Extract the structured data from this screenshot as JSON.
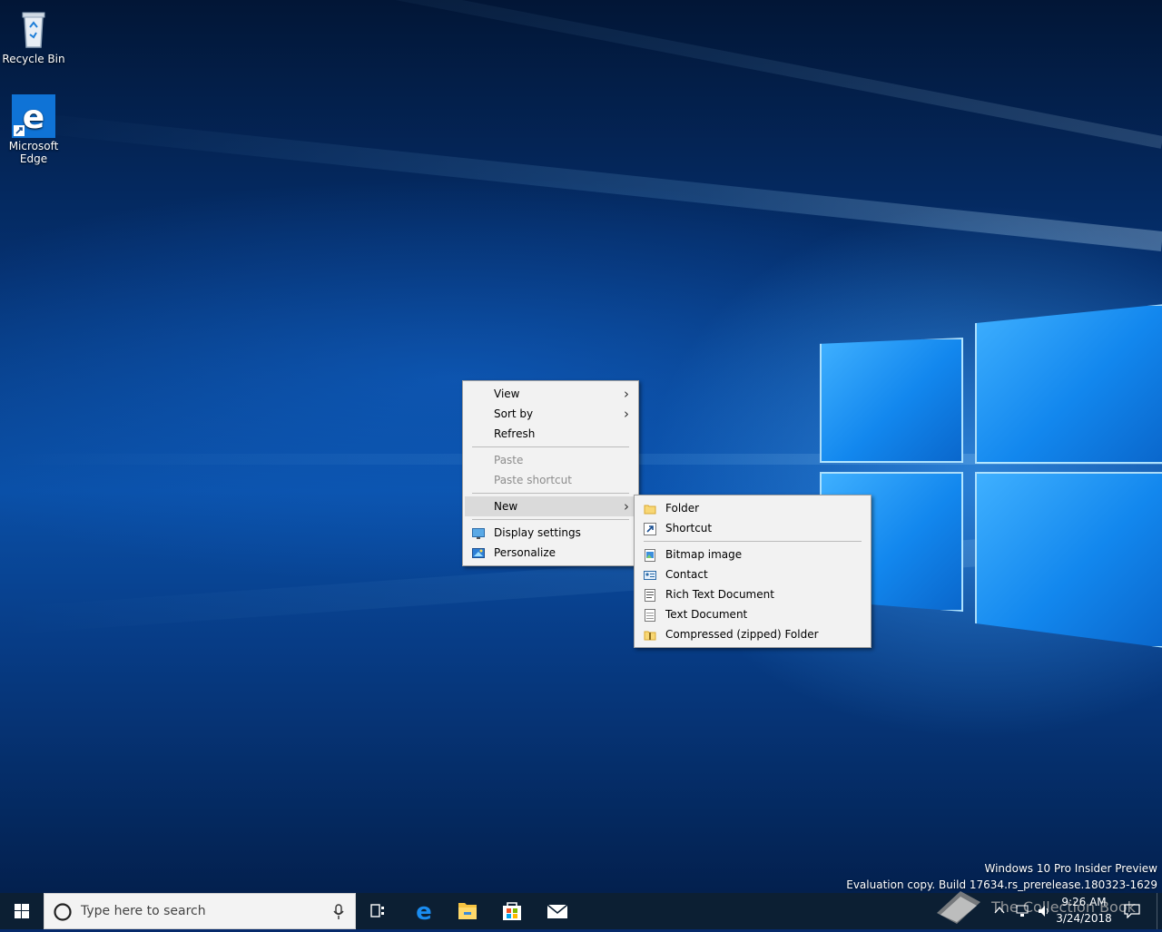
{
  "desktop": {
    "icons": [
      {
        "label": "Recycle Bin",
        "icon": "recycle-bin-icon"
      },
      {
        "label": "Microsoft\nEdge",
        "label_line1": "Microsoft",
        "label_line2": "Edge",
        "icon": "edge-icon"
      }
    ]
  },
  "context_menu": {
    "items": [
      {
        "label": "View",
        "submenu": true
      },
      {
        "label": "Sort by",
        "submenu": true
      },
      {
        "label": "Refresh"
      },
      {
        "label": "Paste",
        "disabled": true
      },
      {
        "label": "Paste shortcut",
        "disabled": true
      },
      {
        "label": "New",
        "submenu": true,
        "active": true
      },
      {
        "label": "Display settings",
        "icon": "display-icon"
      },
      {
        "label": "Personalize",
        "icon": "personalize-icon"
      }
    ]
  },
  "new_submenu": {
    "items": [
      {
        "label": "Folder",
        "icon": "folder-icon"
      },
      {
        "label": "Shortcut",
        "icon": "shortcut-icon"
      },
      {
        "label": "Bitmap image",
        "icon": "bitmap-icon"
      },
      {
        "label": "Contact",
        "icon": "contact-icon"
      },
      {
        "label": "Rich Text Document",
        "icon": "rich-text-icon"
      },
      {
        "label": "Text Document",
        "icon": "text-document-icon"
      },
      {
        "label": "Compressed (zipped) Folder",
        "icon": "zip-folder-icon"
      }
    ]
  },
  "watermark": {
    "line1": "Windows 10 Pro Insider Preview",
    "line2": "Evaluation copy. Build 17634.rs_prerelease.180323-1629"
  },
  "taskbar": {
    "search_placeholder": "Type here to search",
    "clock_time": "9:26 AM",
    "clock_date": "3/24/2018",
    "overlay_text": "The Collection Book",
    "colors": {
      "taskbar": "#0c1f33",
      "accent": "#0078d7"
    }
  }
}
